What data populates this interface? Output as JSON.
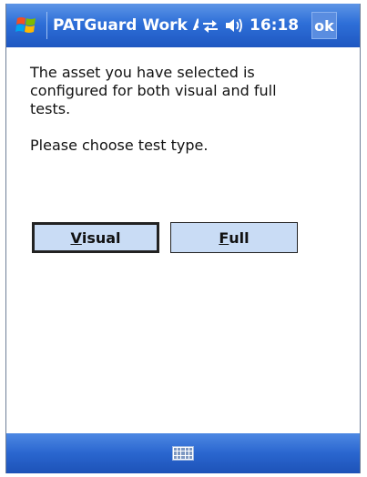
{
  "titlebar": {
    "app_title": "PATGuard Work Al",
    "clock": "16:18",
    "ok_label": "ok",
    "start_icon": "windows-flag-icon",
    "connectivity_icon": "connectivity-icon",
    "volume_icon": "volume-icon"
  },
  "dialog": {
    "message": "The asset you have selected is configured for both visual and full tests.",
    "prompt": "Please choose test type.",
    "visual_button": {
      "accel": "V",
      "rest": "isual"
    },
    "full_button": {
      "accel": "F",
      "rest": "ull"
    }
  },
  "bottombar": {
    "keyboard_icon": "keyboard-icon"
  },
  "colors": {
    "title_bar": "#2e6fd8",
    "button_fill": "#c9dcf5",
    "text": "#111111"
  }
}
